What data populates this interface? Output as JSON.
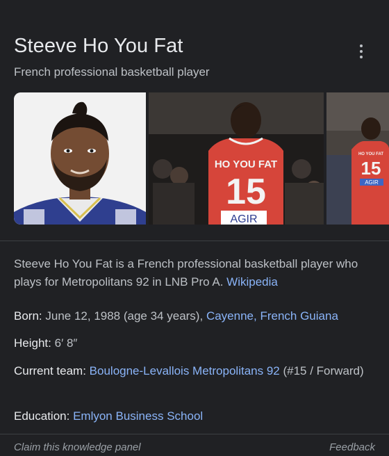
{
  "header": {
    "title": "Steeve Ho You Fat",
    "subtitle": "French professional basketball player",
    "more_icon": "more-vert-icon"
  },
  "images": {
    "photo2_jersey_text": "HO YOU FAT",
    "photo2_jersey_number": "15",
    "photo2_sponsor": "AGIR",
    "photo3_jersey_text": "HO YOU FAT",
    "photo3_jersey_number": "15",
    "photo3_sponsor": "AGIR"
  },
  "description": {
    "text": "Steeve Ho You Fat is a French professional basketball player who plays for Metropolitans 92 in LNB Pro A.",
    "source_link": "Wikipedia"
  },
  "facts": {
    "born": {
      "label": "Born:",
      "value": "June 12, 1988 (age 34 years),",
      "link1": "Cayenne,",
      "link2": "French Guiana"
    },
    "height": {
      "label": "Height:",
      "value": "6′ 8″"
    },
    "team": {
      "label": "Current team:",
      "link": "Boulogne-Levallois Metropolitans 92",
      "value": "(#15 / Forward)"
    },
    "education": {
      "label": "Education:",
      "link": "Emlyon Business School"
    }
  },
  "footer": {
    "claim": "Claim this knowledge panel",
    "feedback": "Feedback"
  },
  "colors": {
    "background": "#202124",
    "link": "#8ab4f8",
    "jersey_red": "#d6453a"
  }
}
